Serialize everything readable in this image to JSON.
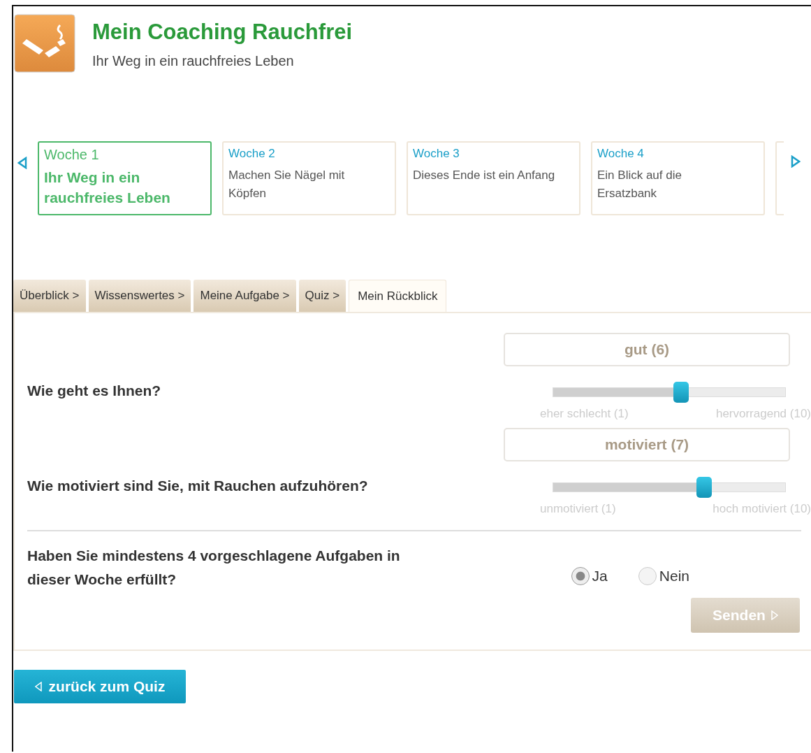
{
  "header": {
    "title": "Mein Coaching Rauchfrei",
    "subtitle": "Ihr Weg in ein rauchfreies Leben"
  },
  "weeks": [
    {
      "label": "Woche 1",
      "title": "Ihr Weg in ein rauchfreies Leben",
      "selected": true
    },
    {
      "label": "Woche 2",
      "title": "Machen Sie Nägel mit Köpfen",
      "selected": false
    },
    {
      "label": "Woche 3",
      "title": "Dieses Ende ist ein Anfang",
      "selected": false
    },
    {
      "label": "Woche 4",
      "title": "Ein Blick auf die Ersatzbank",
      "selected": false
    }
  ],
  "tabs": [
    {
      "label": "Überblick >",
      "selected": false
    },
    {
      "label": "Wissenswertes >",
      "selected": false
    },
    {
      "label": "Meine Aufgabe >",
      "selected": false
    },
    {
      "label": "Quiz >",
      "selected": false
    },
    {
      "label": "Mein Rückblick",
      "selected": true
    }
  ],
  "ratings": [
    {
      "question": "Wie geht es Ihnen?",
      "value_display": "gut (6)",
      "level": 0.55,
      "min_label": "eher schlecht (1)",
      "max_label": "hervorragend (10)"
    },
    {
      "question": "Wie motiviert sind Sie, mit Rauchen aufzuhören?",
      "value_display": "motiviert (7)",
      "level": 0.65,
      "min_label": "unmotiviert (1)",
      "max_label": "hoch motiviert (10)"
    }
  ],
  "task_question": {
    "question": "Haben Sie mindestens 4 vorgeschlagene Aufgaben in dieser Woche erfüllt?",
    "options": [
      {
        "label": "Ja",
        "selected": true
      },
      {
        "label": "Nein",
        "selected": false
      }
    ]
  },
  "submit_button": {
    "label": "Senden"
  },
  "back_button": {
    "label": "zurück zum Quiz"
  }
}
